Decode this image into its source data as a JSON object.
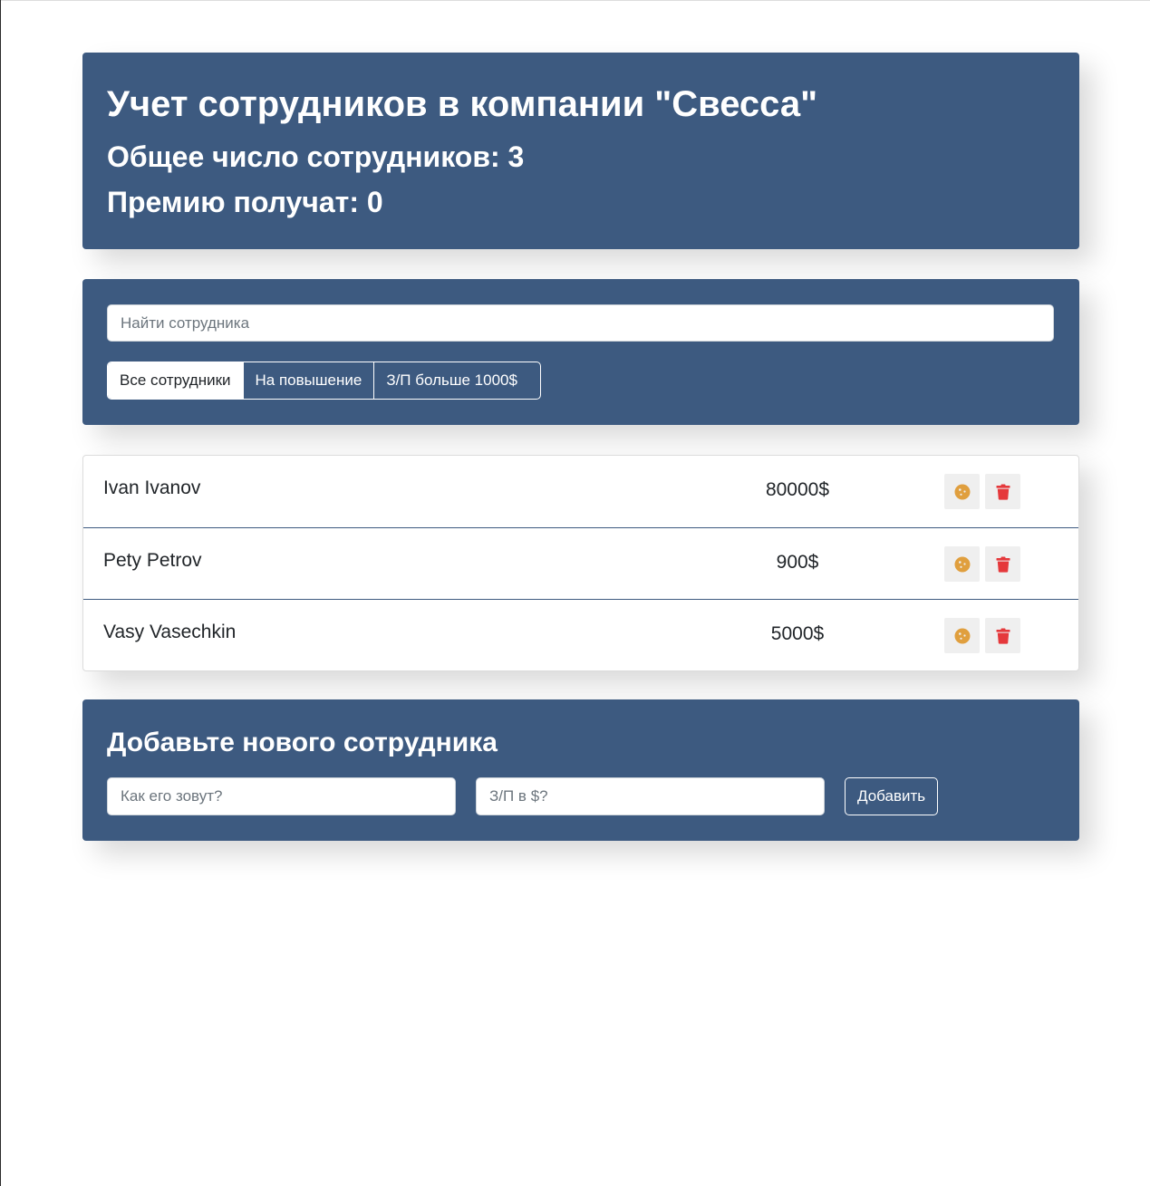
{
  "header": {
    "title": "Учет сотрудников в компании \"Свесса\"",
    "total_label": "Общее число сотрудников: 3",
    "bonus_label": "Премию получат: 0"
  },
  "search": {
    "placeholder": "Найти сотрудника",
    "value": ""
  },
  "filters": [
    {
      "label": "Все сотрудники",
      "active": true
    },
    {
      "label": "На повышение",
      "active": false
    },
    {
      "label": "З/П больше 1000$",
      "active": false
    }
  ],
  "employees": [
    {
      "name": "Ivan Ivanov",
      "salary": "80000$"
    },
    {
      "name": "Pety Petrov",
      "salary": "900$"
    },
    {
      "name": "Vasy Vasechkin",
      "salary": "5000$"
    }
  ],
  "add_form": {
    "title": "Добавьте нового сотрудника",
    "name_placeholder": "Как его зовут?",
    "salary_placeholder": "З/П в $?",
    "submit_label": "Добавить"
  },
  "colors": {
    "panel": "#3d5a80",
    "cookie_icon": "#e09f3e",
    "trash_icon": "#e5383b"
  },
  "icons": {
    "cookie": "cookie-icon",
    "trash": "trash-icon"
  }
}
